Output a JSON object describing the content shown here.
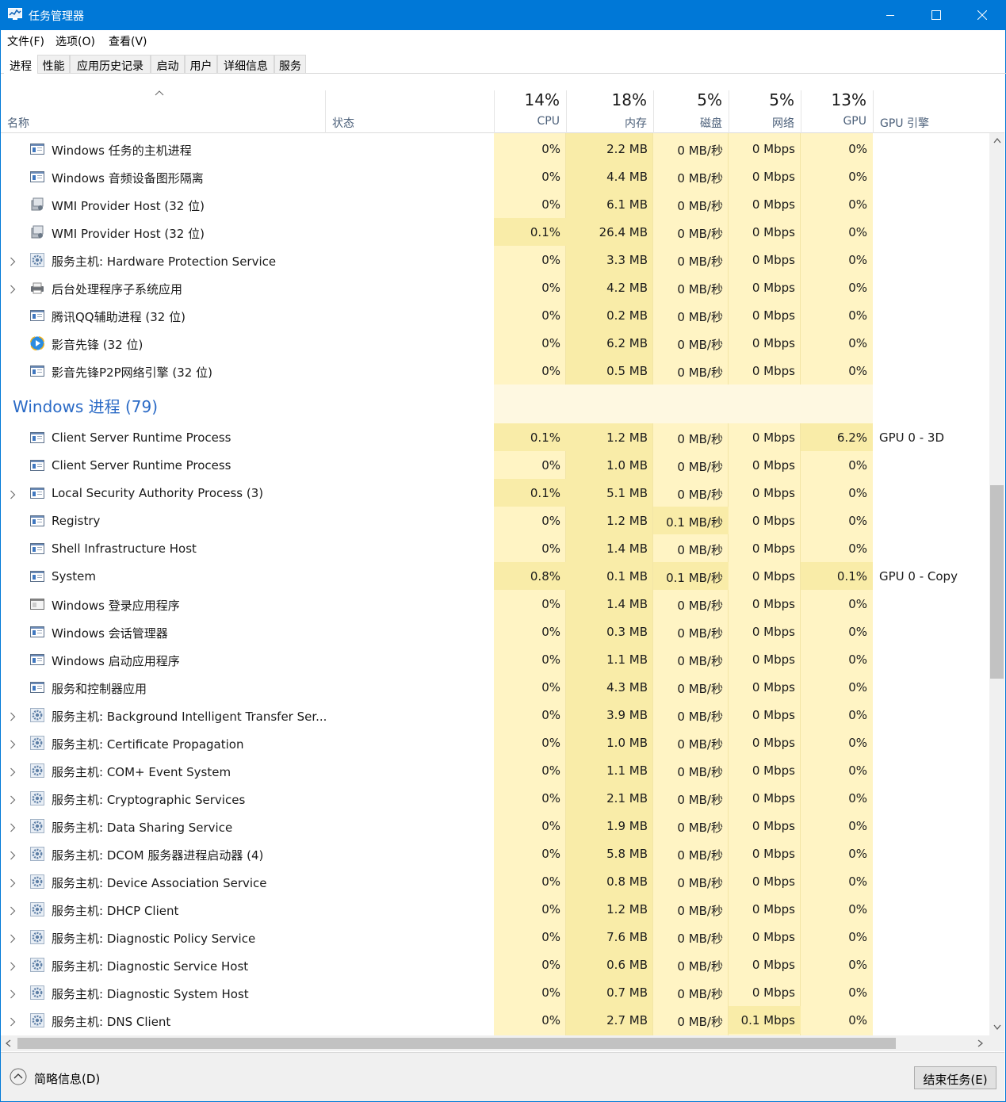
{
  "window": {
    "title": "任务管理器"
  },
  "menu": [
    "文件(F)",
    "选项(O)",
    "查看(V)"
  ],
  "tabs": [
    "进程",
    "性能",
    "应用历史记录",
    "启动",
    "用户",
    "详细信息",
    "服务"
  ],
  "active_tab": "进程",
  "header": {
    "name": "名称",
    "status": "状态",
    "cpu": {
      "pct": "14%",
      "label": "CPU"
    },
    "mem": {
      "pct": "18%",
      "label": "内存"
    },
    "disk": {
      "pct": "5%",
      "label": "磁盘"
    },
    "net": {
      "pct": "5%",
      "label": "网络"
    },
    "gpu": {
      "pct": "13%",
      "label": "GPU"
    },
    "gpu_engine": "GPU 引擎"
  },
  "group": {
    "title": "Windows 进程 (79)"
  },
  "rows_top": [
    {
      "name": "Windows 任务的主机进程",
      "icon": "window-icon",
      "expand": false,
      "cpu": "0%",
      "mem": "2.2 MB",
      "disk": "0 MB/秒",
      "net": "0 Mbps",
      "gpu": "0%",
      "eng": ""
    },
    {
      "name": "Windows 音频设备图形隔离",
      "icon": "window-icon",
      "expand": false,
      "cpu": "0%",
      "mem": "4.4 MB",
      "disk": "0 MB/秒",
      "net": "0 Mbps",
      "gpu": "0%",
      "eng": ""
    },
    {
      "name": "WMI Provider Host (32 位)",
      "icon": "wmi-icon",
      "expand": false,
      "cpu": "0%",
      "mem": "6.1 MB",
      "disk": "0 MB/秒",
      "net": "0 Mbps",
      "gpu": "0%",
      "eng": ""
    },
    {
      "name": "WMI Provider Host (32 位)",
      "icon": "wmi-icon",
      "expand": false,
      "cpu": "0.1%",
      "mem": "26.4 MB",
      "disk": "0 MB/秒",
      "net": "0 Mbps",
      "gpu": "0%",
      "eng": ""
    },
    {
      "name": "服务主机: Hardware Protection Service",
      "icon": "gear-icon",
      "expand": true,
      "cpu": "0%",
      "mem": "3.3 MB",
      "disk": "0 MB/秒",
      "net": "0 Mbps",
      "gpu": "0%",
      "eng": ""
    },
    {
      "name": "后台处理程序子系统应用",
      "icon": "printer-icon",
      "expand": true,
      "cpu": "0%",
      "mem": "4.2 MB",
      "disk": "0 MB/秒",
      "net": "0 Mbps",
      "gpu": "0%",
      "eng": ""
    },
    {
      "name": "腾讯QQ辅助进程 (32 位)",
      "icon": "window-icon",
      "expand": false,
      "cpu": "0%",
      "mem": "0.2 MB",
      "disk": "0 MB/秒",
      "net": "0 Mbps",
      "gpu": "0%",
      "eng": ""
    },
    {
      "name": "影音先锋 (32 位)",
      "icon": "player-icon",
      "expand": false,
      "cpu": "0%",
      "mem": "6.2 MB",
      "disk": "0 MB/秒",
      "net": "0 Mbps",
      "gpu": "0%",
      "eng": ""
    },
    {
      "name": "影音先锋P2P网络引擎 (32 位)",
      "icon": "window-icon",
      "expand": false,
      "cpu": "0%",
      "mem": "0.5 MB",
      "disk": "0 MB/秒",
      "net": "0 Mbps",
      "gpu": "0%",
      "eng": ""
    }
  ],
  "rows_win": [
    {
      "name": "Client Server Runtime Process",
      "icon": "window-icon",
      "expand": false,
      "cpu": "0.1%",
      "mem": "1.2 MB",
      "disk": "0 MB/秒",
      "net": "0 Mbps",
      "gpu": "6.2%",
      "eng": "GPU 0 - 3D"
    },
    {
      "name": "Client Server Runtime Process",
      "icon": "window-icon",
      "expand": false,
      "cpu": "0%",
      "mem": "1.0 MB",
      "disk": "0 MB/秒",
      "net": "0 Mbps",
      "gpu": "0%",
      "eng": ""
    },
    {
      "name": "Local Security Authority Process (3)",
      "icon": "window-icon",
      "expand": true,
      "cpu": "0.1%",
      "mem": "5.1 MB",
      "disk": "0 MB/秒",
      "net": "0 Mbps",
      "gpu": "0%",
      "eng": ""
    },
    {
      "name": "Registry",
      "icon": "window-icon",
      "expand": false,
      "cpu": "0%",
      "mem": "1.2 MB",
      "disk": "0.1 MB/秒",
      "net": "0 Mbps",
      "gpu": "0%",
      "eng": ""
    },
    {
      "name": "Shell Infrastructure Host",
      "icon": "window-icon",
      "expand": false,
      "cpu": "0%",
      "mem": "1.4 MB",
      "disk": "0 MB/秒",
      "net": "0 Mbps",
      "gpu": "0%",
      "eng": ""
    },
    {
      "name": "System",
      "icon": "window-icon",
      "expand": false,
      "cpu": "0.8%",
      "mem": "0.1 MB",
      "disk": "0.1 MB/秒",
      "net": "0 Mbps",
      "gpu": "0.1%",
      "eng": "GPU 0 - Copy"
    },
    {
      "name": "Windows 登录应用程序",
      "icon": "logon-icon",
      "expand": false,
      "cpu": "0%",
      "mem": "1.4 MB",
      "disk": "0 MB/秒",
      "net": "0 Mbps",
      "gpu": "0%",
      "eng": ""
    },
    {
      "name": "Windows 会话管理器",
      "icon": "window-icon",
      "expand": false,
      "cpu": "0%",
      "mem": "0.3 MB",
      "disk": "0 MB/秒",
      "net": "0 Mbps",
      "gpu": "0%",
      "eng": ""
    },
    {
      "name": "Windows 启动应用程序",
      "icon": "window-icon",
      "expand": false,
      "cpu": "0%",
      "mem": "1.1 MB",
      "disk": "0 MB/秒",
      "net": "0 Mbps",
      "gpu": "0%",
      "eng": ""
    },
    {
      "name": "服务和控制器应用",
      "icon": "window-icon",
      "expand": false,
      "cpu": "0%",
      "mem": "4.3 MB",
      "disk": "0 MB/秒",
      "net": "0 Mbps",
      "gpu": "0%",
      "eng": ""
    },
    {
      "name": "服务主机: Background Intelligent Transfer Ser...",
      "icon": "gear-icon",
      "expand": true,
      "cpu": "0%",
      "mem": "3.9 MB",
      "disk": "0 MB/秒",
      "net": "0 Mbps",
      "gpu": "0%",
      "eng": ""
    },
    {
      "name": "服务主机: Certificate Propagation",
      "icon": "gear-icon",
      "expand": true,
      "cpu": "0%",
      "mem": "1.0 MB",
      "disk": "0 MB/秒",
      "net": "0 Mbps",
      "gpu": "0%",
      "eng": ""
    },
    {
      "name": "服务主机: COM+ Event System",
      "icon": "gear-icon",
      "expand": true,
      "cpu": "0%",
      "mem": "1.1 MB",
      "disk": "0 MB/秒",
      "net": "0 Mbps",
      "gpu": "0%",
      "eng": ""
    },
    {
      "name": "服务主机: Cryptographic Services",
      "icon": "gear-icon",
      "expand": true,
      "cpu": "0%",
      "mem": "2.1 MB",
      "disk": "0 MB/秒",
      "net": "0 Mbps",
      "gpu": "0%",
      "eng": ""
    },
    {
      "name": "服务主机: Data Sharing Service",
      "icon": "gear-icon",
      "expand": true,
      "cpu": "0%",
      "mem": "1.9 MB",
      "disk": "0 MB/秒",
      "net": "0 Mbps",
      "gpu": "0%",
      "eng": ""
    },
    {
      "name": "服务主机: DCOM 服务器进程启动器 (4)",
      "icon": "gear-icon",
      "expand": true,
      "cpu": "0%",
      "mem": "5.8 MB",
      "disk": "0 MB/秒",
      "net": "0 Mbps",
      "gpu": "0%",
      "eng": ""
    },
    {
      "name": "服务主机: Device Association Service",
      "icon": "gear-icon",
      "expand": true,
      "cpu": "0%",
      "mem": "0.8 MB",
      "disk": "0 MB/秒",
      "net": "0 Mbps",
      "gpu": "0%",
      "eng": ""
    },
    {
      "name": "服务主机: DHCP Client",
      "icon": "gear-icon",
      "expand": true,
      "cpu": "0%",
      "mem": "1.2 MB",
      "disk": "0 MB/秒",
      "net": "0 Mbps",
      "gpu": "0%",
      "eng": ""
    },
    {
      "name": "服务主机: Diagnostic Policy Service",
      "icon": "gear-icon",
      "expand": true,
      "cpu": "0%",
      "mem": "7.6 MB",
      "disk": "0 MB/秒",
      "net": "0 Mbps",
      "gpu": "0%",
      "eng": ""
    },
    {
      "name": "服务主机: Diagnostic Service Host",
      "icon": "gear-icon",
      "expand": true,
      "cpu": "0%",
      "mem": "0.6 MB",
      "disk": "0 MB/秒",
      "net": "0 Mbps",
      "gpu": "0%",
      "eng": ""
    },
    {
      "name": "服务主机: Diagnostic System Host",
      "icon": "gear-icon",
      "expand": true,
      "cpu": "0%",
      "mem": "0.7 MB",
      "disk": "0 MB/秒",
      "net": "0 Mbps",
      "gpu": "0%",
      "eng": ""
    },
    {
      "name": "服务主机: DNS Client",
      "icon": "gear-icon",
      "expand": true,
      "cpu": "0%",
      "mem": "2.7 MB",
      "disk": "0 MB/秒",
      "net": "0.1 Mbps",
      "gpu": "0%",
      "eng": ""
    }
  ],
  "footer": {
    "fewer_details": "简略信息(D)",
    "end_task": "结束任务(E)"
  },
  "colors": {
    "accent": "#0078d7",
    "heat_light": "#fff4c4",
    "heat_med": "#f9eca8",
    "group_title": "#2a6ac6"
  }
}
